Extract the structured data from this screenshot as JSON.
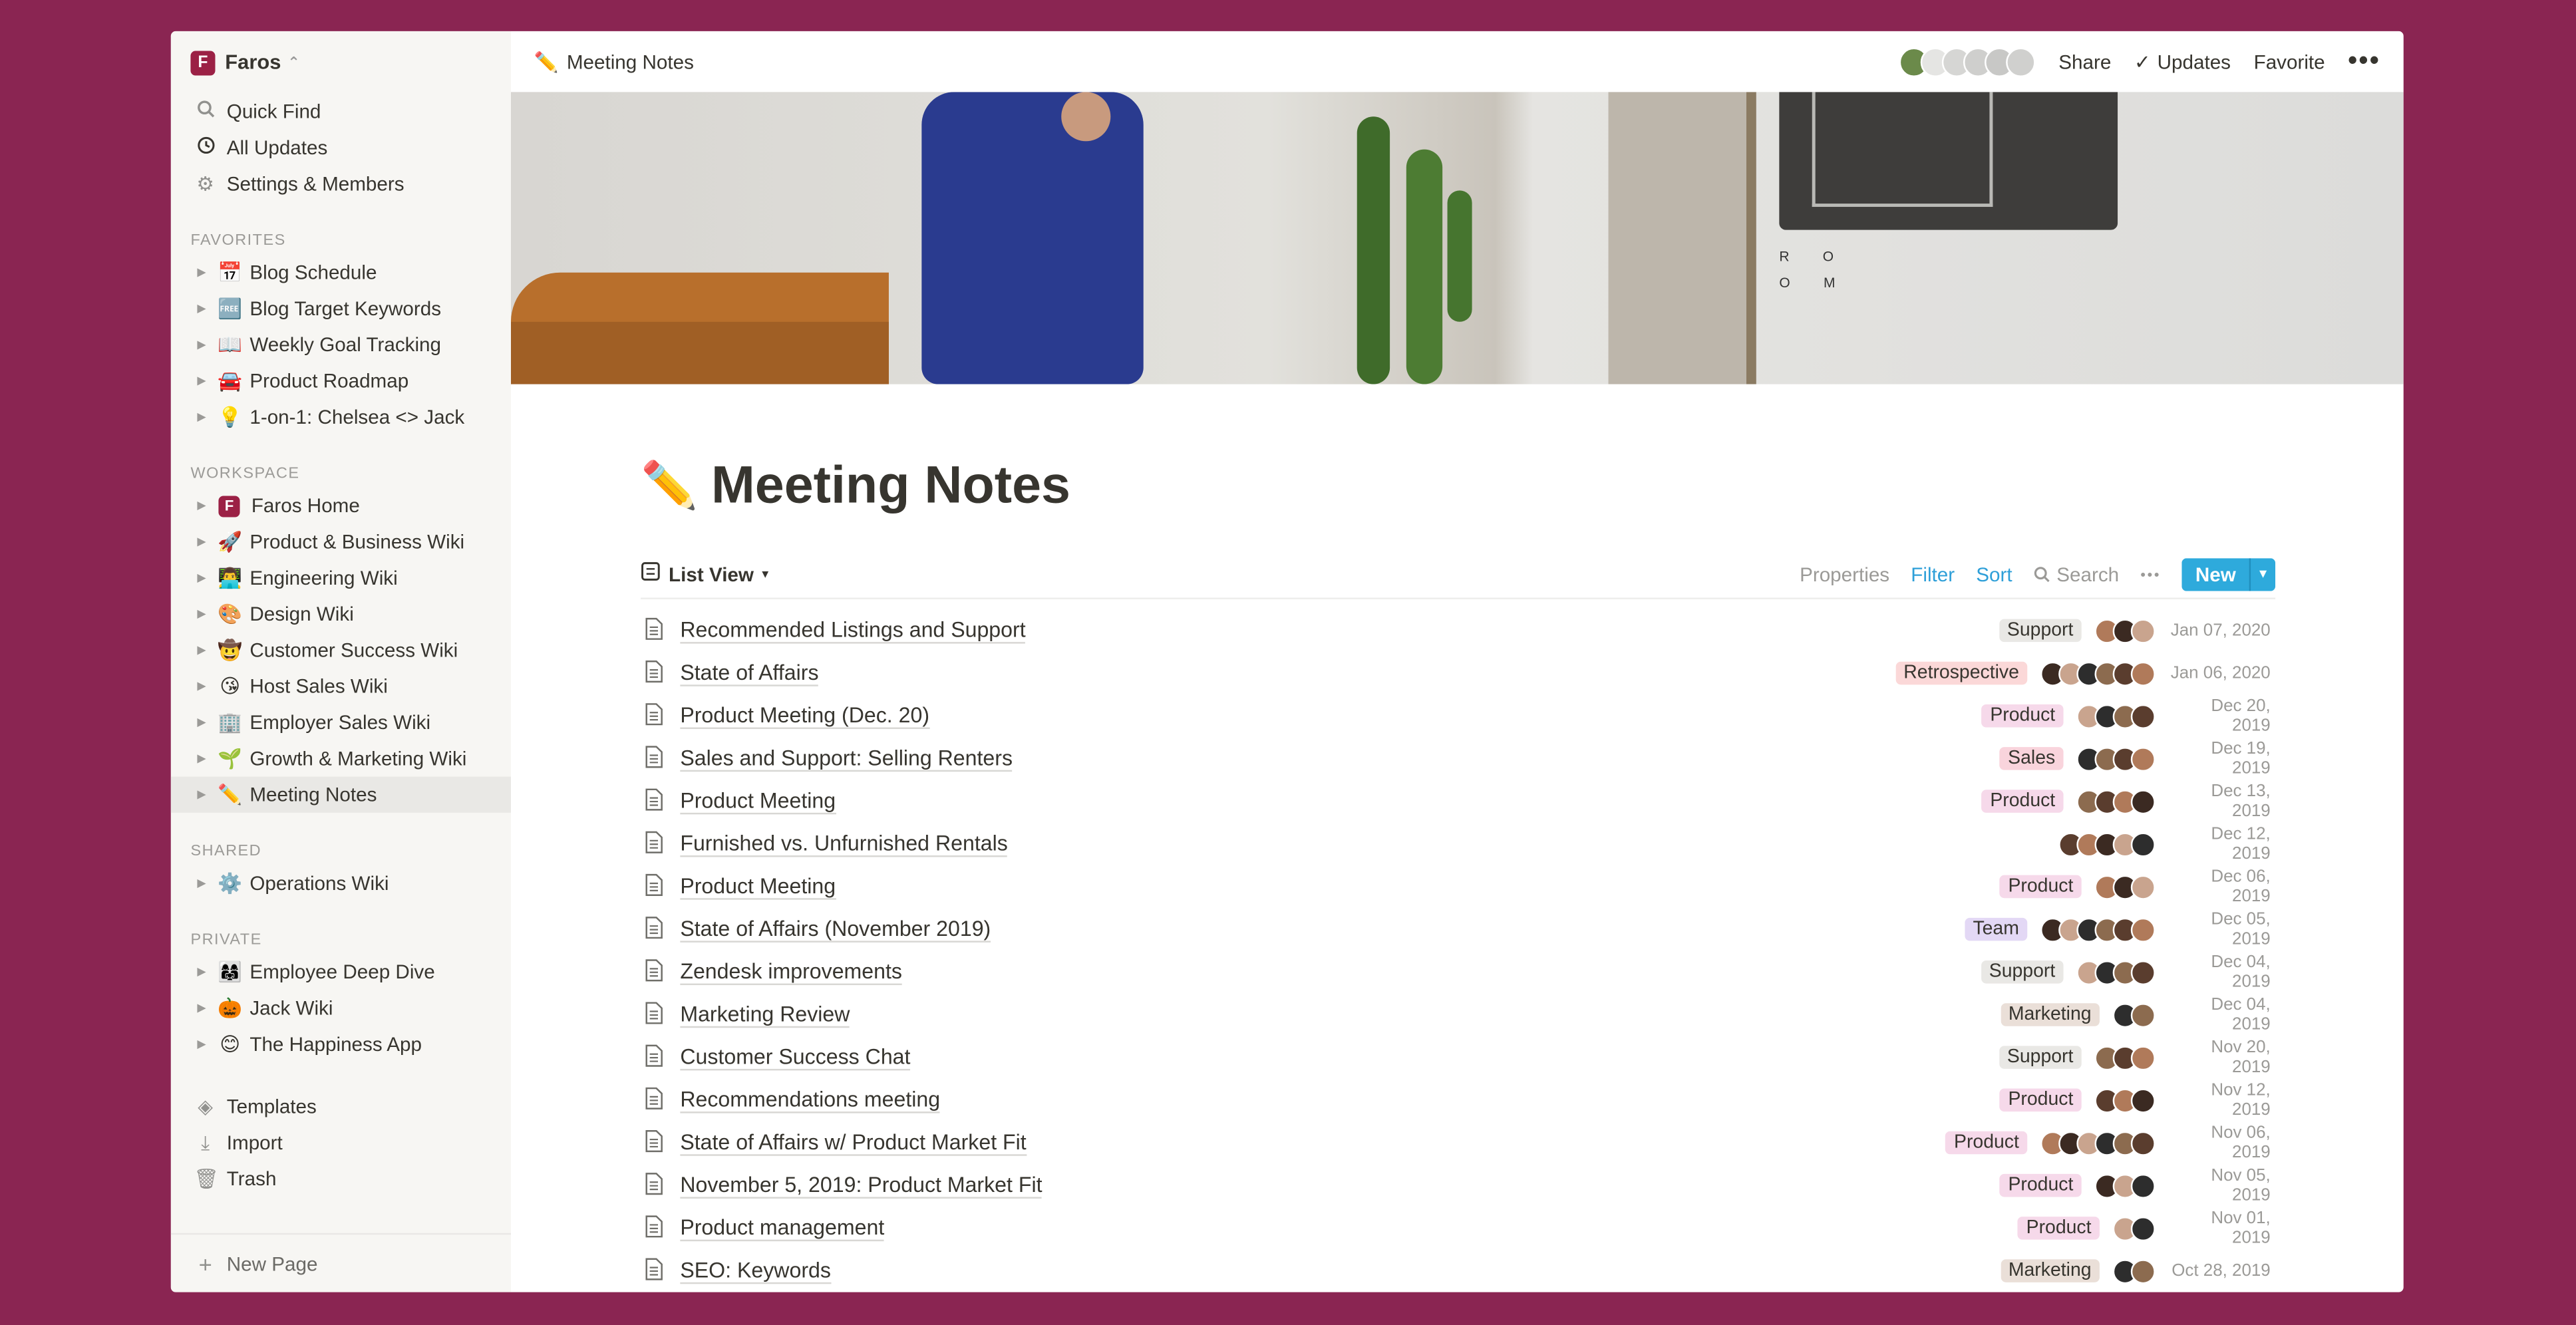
{
  "colors": {
    "background": "#8a2552",
    "accent_blue": "#2eaadc",
    "tag_support": "#e9e8e5",
    "tag_retrospective": "#fbd8d8",
    "tag_product": "#f6d9ea",
    "tag_sales": "#f9d4dc",
    "tag_team": "#e3d8f5",
    "tag_marketing": "#eadfd8"
  },
  "sidebar": {
    "workspace_name": "Faros",
    "workspace_logo_letter": "F",
    "nav": [
      {
        "label": "Quick Find",
        "icon": "search-icon"
      },
      {
        "label": "All Updates",
        "icon": "clock-icon"
      },
      {
        "label": "Settings & Members",
        "icon": "gear-icon"
      }
    ],
    "favorites_label": "FAVORITES",
    "favorites": [
      {
        "emoji": "📅",
        "label": "Blog Schedule"
      },
      {
        "emoji": "🆓",
        "label": "Blog Target Keywords"
      },
      {
        "emoji": "📖",
        "label": "Weekly Goal Tracking"
      },
      {
        "emoji": "🚘",
        "label": "Product Roadmap"
      },
      {
        "emoji": "💡",
        "label": "1-on-1: Chelsea <> Jack"
      }
    ],
    "workspace_label": "WORKSPACE",
    "workspace": [
      {
        "emoji": "F",
        "label": "Faros Home"
      },
      {
        "emoji": "🚀",
        "label": "Product & Business Wiki"
      },
      {
        "emoji": "👨‍💻",
        "label": "Engineering Wiki"
      },
      {
        "emoji": "🎨",
        "label": "Design Wiki"
      },
      {
        "emoji": "🤠",
        "label": "Customer Success Wiki"
      },
      {
        "emoji": "😘",
        "label": "Host Sales Wiki"
      },
      {
        "emoji": "🏢",
        "label": "Employer Sales Wiki"
      },
      {
        "emoji": "🌱",
        "label": "Growth & Marketing Wiki"
      },
      {
        "emoji": "✏️",
        "label": "Meeting Notes"
      }
    ],
    "shared_label": "SHARED",
    "shared": [
      {
        "emoji": "⚙️",
        "label": "Operations Wiki"
      }
    ],
    "private_label": "PRIVATE",
    "private": [
      {
        "emoji": "👩‍👩‍👧",
        "label": "Employee Deep Dive"
      },
      {
        "emoji": "🎃",
        "label": "Jack Wiki"
      },
      {
        "emoji": "😊",
        "label": "The Happiness App"
      }
    ],
    "bottom": [
      {
        "label": "Templates",
        "icon": "templates-icon"
      },
      {
        "label": "Import",
        "icon": "import-icon"
      },
      {
        "label": "Trash",
        "icon": "trash-icon"
      }
    ],
    "new_page": "New Page"
  },
  "topbar": {
    "breadcrumb_emoji": "✏️",
    "breadcrumb": "Meeting Notes",
    "share": "Share",
    "updates": "Updates",
    "favorite": "Favorite",
    "more": "•••"
  },
  "cover": {
    "room_text_1": "R O",
    "room_text_2": "O M"
  },
  "page": {
    "emoji": "✏️",
    "title": "Meeting Notes",
    "view_label": "List View",
    "properties": "Properties",
    "filter": "Filter",
    "sort": "Sort",
    "search": "Search",
    "more": "•••",
    "new": "New"
  },
  "rows": [
    {
      "title": "Recommended Listings and Support",
      "tag": "Support",
      "tag_color": "#e9e8e5",
      "avatars": 3,
      "date": "Jan 07, 2020"
    },
    {
      "title": "State of Affairs",
      "tag": "Retrospective",
      "tag_color": "#fbd8d8",
      "avatars": 6,
      "date": "Jan 06, 2020"
    },
    {
      "title": "Product Meeting (Dec. 20)",
      "tag": "Product",
      "tag_color": "#f6d9ea",
      "avatars": 4,
      "date": "Dec 20, 2019"
    },
    {
      "title": "Sales and Support: Selling Renters",
      "tag": "Sales",
      "tag_color": "#f9d4dc",
      "avatars": 4,
      "date": "Dec 19, 2019"
    },
    {
      "title": "Product Meeting",
      "tag": "Product",
      "tag_color": "#f6d9ea",
      "avatars": 4,
      "date": "Dec 13, 2019"
    },
    {
      "title": "Furnished vs. Unfurnished Rentals",
      "tag": "",
      "tag_color": "",
      "avatars": 5,
      "date": "Dec 12, 2019"
    },
    {
      "title": "Product Meeting",
      "tag": "Product",
      "tag_color": "#f6d9ea",
      "avatars": 3,
      "date": "Dec 06, 2019"
    },
    {
      "title": "State of Affairs (November 2019)",
      "tag": "Team",
      "tag_color": "#e3d8f5",
      "avatars": 6,
      "date": "Dec 05, 2019"
    },
    {
      "title": "Zendesk improvements",
      "tag": "Support",
      "tag_color": "#e9e8e5",
      "avatars": 4,
      "date": "Dec 04, 2019"
    },
    {
      "title": "Marketing Review",
      "tag": "Marketing",
      "tag_color": "#eadfd8",
      "avatars": 2,
      "date": "Dec 04, 2019"
    },
    {
      "title": "Customer Success Chat",
      "tag": "Support",
      "tag_color": "#e9e8e5",
      "avatars": 3,
      "date": "Nov 20, 2019"
    },
    {
      "title": "Recommendations meeting",
      "tag": "Product",
      "tag_color": "#f6d9ea",
      "avatars": 3,
      "date": "Nov 12, 2019"
    },
    {
      "title": "State of Affairs w/ Product Market Fit",
      "tag": "Product",
      "tag_color": "#f6d9ea",
      "avatars": 6,
      "date": "Nov 06, 2019"
    },
    {
      "title": "November 5, 2019: Product Market Fit",
      "tag": "Product",
      "tag_color": "#f6d9ea",
      "avatars": 3,
      "date": "Nov 05, 2019"
    },
    {
      "title": "Product management",
      "tag": "Product",
      "tag_color": "#f6d9ea",
      "avatars": 2,
      "date": "Nov 01, 2019"
    },
    {
      "title": "SEO: Keywords",
      "tag": "Marketing",
      "tag_color": "#eadfd8",
      "avatars": 2,
      "date": "Oct 28, 2019"
    }
  ]
}
